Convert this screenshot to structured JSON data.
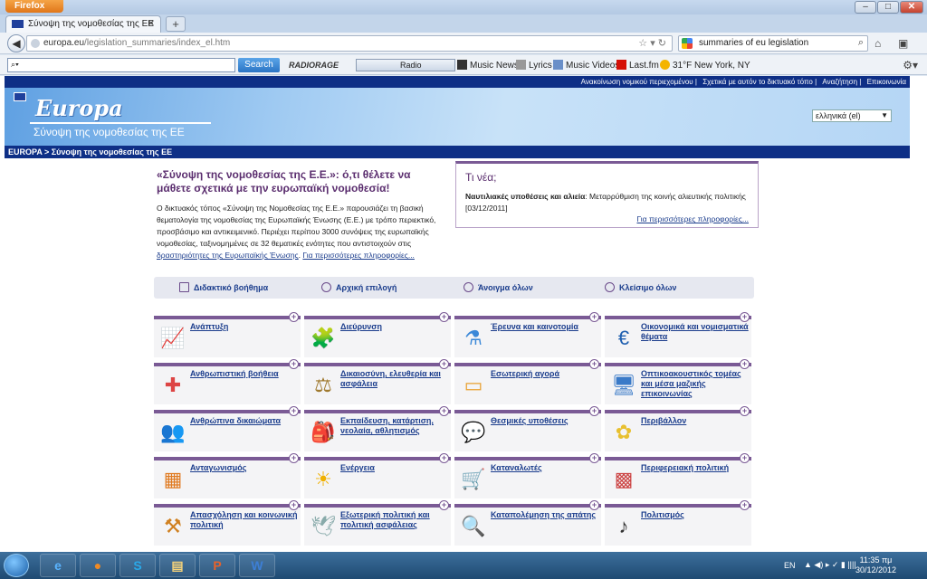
{
  "browser": {
    "app_button": "Firefox",
    "tab_title": "Σύνοψη της νομοθεσίας της ΕΕ",
    "url_domain": "europa.eu",
    "url_path": "/legislation_summaries/index_el.htm",
    "search_value": "summaries of eu legislation",
    "toolbar": {
      "search_placeholder": "",
      "search_button": "Search",
      "radio_brand": "RADIORAGE",
      "radio_label": "Radio",
      "links": [
        "Music News",
        "Lyrics",
        "Music Videos",
        "Last.fm",
        "31°F New York, NY"
      ]
    }
  },
  "site": {
    "top_links": [
      "Ανακοίνωση νομικού περιεχομένου",
      "Σχετικά με αυτόν το δικτυακό τόπο",
      "Αναζήτηση",
      "Επικοινωνία"
    ],
    "logo": "Europa",
    "subtitle": "Σύνοψη της νομοθεσίας της ΕΕ",
    "language": "ελληνικά (el)",
    "breadcrumb": "EUROPA > Σύνοψη της νομοθεσίας της ΕΕ"
  },
  "intro": {
    "title": "«Σύνοψη της νομοθεσίας της Ε.Ε.»: ό,τι θέλετε να μάθετε σχετικά με την ευρωπαϊκή νομοθεσία!",
    "body": "Ο δικτυακός τόπος «Σύνοψη της Νομοθεσίας της Ε.Ε.» παρουσιάζει τη βασική θεματολογία της νομοθεσίας της Ευρωπαϊκής Ένωσης (Ε.Ε.) με τρόπο περιεκτικό, προσβάσιμο και αντικειμενικό. Περιέχει περίπου 3000 συνόψεις της ευρωπαϊκής νομοθεσίας, ταξινομημένες σε 32 θεματικές ενότητες που αντιστοιχούν στις ",
    "link1": "δραστηριότητες της Ευρωπαϊκής Ένωσης",
    "sep": ". ",
    "link2": "Για περισσότερες πληροφορίες..."
  },
  "news": {
    "title": "Τι νέα;",
    "item_bold": "Ναυτιλιακές υποθέσεις και αλιεία",
    "item_text": ": Μεταρρύθμιση της κοινής αλιευτικής πολιτικής [03/12/2011]",
    "more": "Για περισσότερες πληροφορίες..."
  },
  "actions": [
    "Διδακτικό βοήθημα",
    "Αρχική επιλογή",
    "Άνοιγμα όλων",
    "Κλείσιμο όλων"
  ],
  "topics": [
    {
      "label": "Ανάπτυξη",
      "icon": "chart-icon"
    },
    {
      "label": "Διεύρυνση",
      "icon": "puzzle-icon"
    },
    {
      "label": "Έρευνα και καινοτομία",
      "icon": "flask-icon"
    },
    {
      "label": "Οικονομικά και νομισματικά θέματα",
      "icon": "euro-icon"
    },
    {
      "label": "Ανθρωπιστική βοήθεια",
      "icon": "bandage-icon"
    },
    {
      "label": "Δικαιοσύνη, ελευθερία και ασφάλεια",
      "icon": "scales-icon"
    },
    {
      "label": "Εσωτερική αγορά",
      "icon": "ticket-icon"
    },
    {
      "label": "Οπτικοακουστικός τομέας και μέσα μαζικής επικοινωνίας",
      "icon": "monitor-icon"
    },
    {
      "label": "Ανθρώπινα δικαιώματα",
      "icon": "people-icon"
    },
    {
      "label": "Εκπαίδευση, κατάρτιση, νεολαία, αθλητισμός",
      "icon": "backpack-icon"
    },
    {
      "label": "Θεσμικές υποθέσεις",
      "icon": "speech-icon"
    },
    {
      "label": "Περιβάλλον",
      "icon": "flower-icon"
    },
    {
      "label": "Ανταγωνισμός",
      "icon": "bars-icon"
    },
    {
      "label": "Ενέργεια",
      "icon": "sun-icon"
    },
    {
      "label": "Καταναλωτές",
      "icon": "cart-icon"
    },
    {
      "label": "Περιφερειακή πολιτική",
      "icon": "cube-icon"
    },
    {
      "label": "Απασχόληση και κοινωνική πολιτική",
      "icon": "worker-icon"
    },
    {
      "label": "Εξωτερική πολιτική και πολιτική ασφάλειας",
      "icon": "dove-icon"
    },
    {
      "label": "Καταπολέμηση της απάτης",
      "icon": "magnifier-icon"
    },
    {
      "label": "Πολιτισμός",
      "icon": "music-icon"
    }
  ],
  "taskbar": {
    "lang": "EN",
    "time": "11:35 πμ",
    "date": "30/12/2012"
  }
}
